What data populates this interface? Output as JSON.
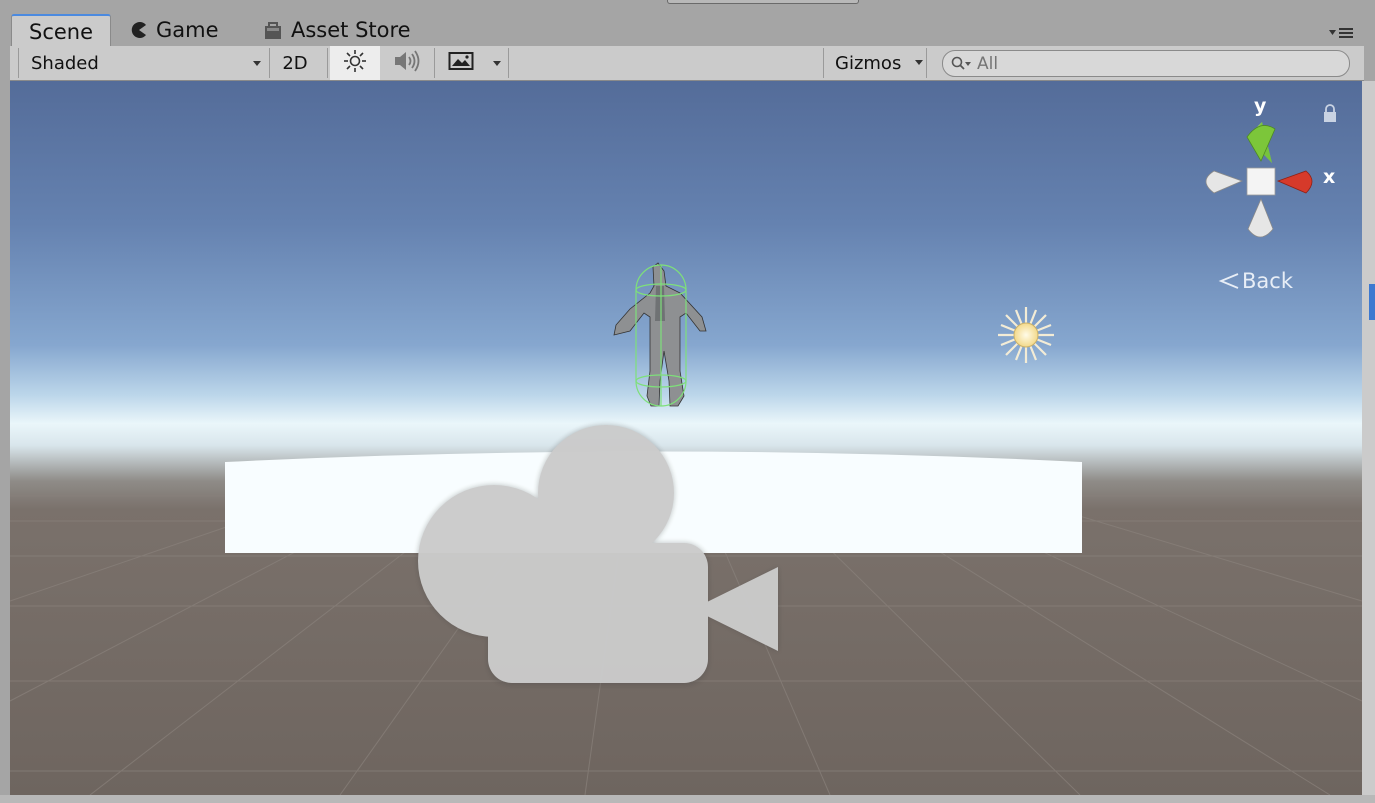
{
  "tabs": {
    "scene": "Scene",
    "game": "Game",
    "asset_store": "Asset Store"
  },
  "toolbar": {
    "draw_mode": "Shaded",
    "mode_2d": "2D",
    "gizmos": "Gizmos",
    "search_placeholder": "All"
  },
  "gizmo": {
    "y_label": "y",
    "x_label": "x",
    "view_label": "Back"
  },
  "icons": [
    "game-pacman-icon",
    "asset-store-bag-icon",
    "lighting-toggle-icon",
    "audio-toggle-icon",
    "effects-toggle-icon",
    "search-icon",
    "lock-icon",
    "directional-light-icon",
    "camera-gizmo-icon"
  ],
  "colors": {
    "active_tab_accent": "#4b8ae0",
    "gizmo_y": "#7cc63a",
    "gizmo_x": "#d63a2a"
  }
}
